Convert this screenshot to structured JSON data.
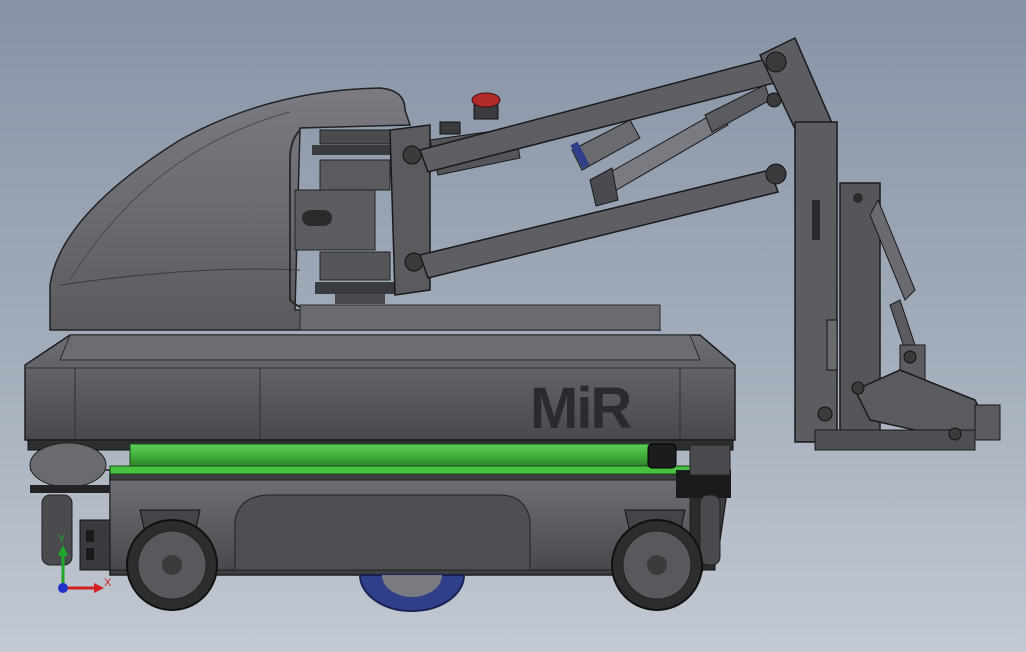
{
  "model": {
    "brand_logo": "MiR",
    "colors": {
      "body": "#5c5d60",
      "body_dark": "#3b3c3f",
      "body_light": "#7a7b7f",
      "arm": "#5a5b5e",
      "green_strip": "#3fae3a",
      "wheel_blue": "#2f3f8a",
      "estop_red": "#b02a2a"
    }
  },
  "triad": {
    "x_label": "X",
    "y_label": "Y",
    "colors": {
      "x": "#d42020",
      "y": "#1fa82a",
      "z": "#2030c8"
    }
  }
}
